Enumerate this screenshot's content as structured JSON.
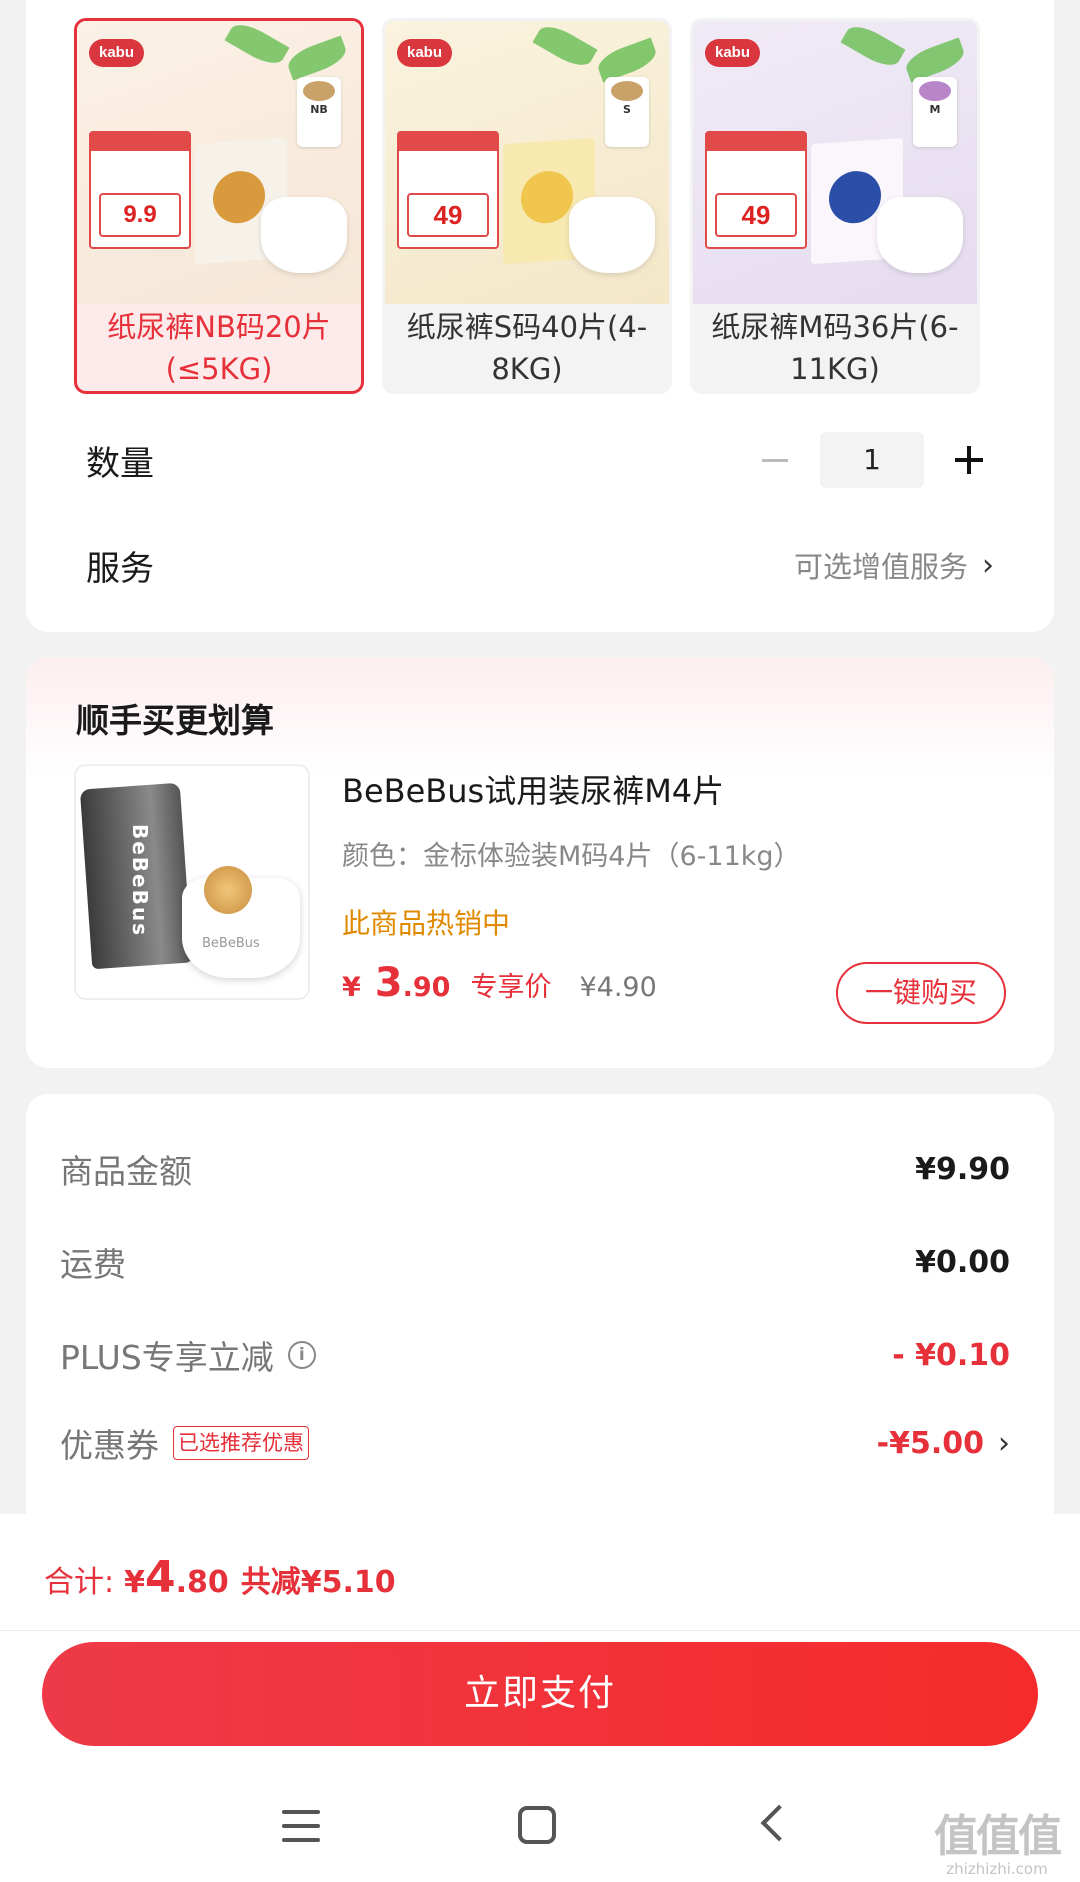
{
  "variants": [
    {
      "label": "纸尿裤NB码20片(≤5KG)",
      "selected": true,
      "brand": "kabu",
      "size_tag": "NB",
      "promo_price": "9.9"
    },
    {
      "label": "纸尿裤S码40片(4-8KG)",
      "selected": false,
      "brand": "kabu",
      "size_tag": "S",
      "promo_price": "49"
    },
    {
      "label": "纸尿裤M码36片(6-11KG)",
      "selected": false,
      "brand": "kabu",
      "size_tag": "M",
      "promo_price": "49"
    }
  ],
  "quantity": {
    "label": "数量",
    "value": "1"
  },
  "service": {
    "label": "服务",
    "value": "可选增值服务"
  },
  "addon": {
    "title": "顺手买更划算",
    "name": "BeBeBus试用装尿裤M4片",
    "spec": "颜色：金标体验装M码4片（6-11kg）",
    "status": "此商品热销中",
    "price_symbol": "¥",
    "price_int": "3",
    "price_dec": ".90",
    "price_tag": "专享价",
    "orig_price": "¥4.90",
    "buy_label": "一键购买",
    "thumb_brand": "BeBeBus"
  },
  "summary": {
    "items": [
      {
        "label": "商品金额",
        "value": "¥9.90",
        "red": false
      },
      {
        "label": "运费",
        "value": "¥0.00",
        "red": false
      },
      {
        "label": "PLUS专享立减",
        "value": "- ¥0.10",
        "red": true,
        "info": true
      },
      {
        "label": "优惠券",
        "value": "-¥5.00",
        "red": true,
        "badge": "已选推荐优惠",
        "chevron": true
      }
    ]
  },
  "total": {
    "label": "合计:",
    "symbol": "¥",
    "int": "4",
    "dec": ".80",
    "saved": "共减¥5.10"
  },
  "pay_button": "立即支付",
  "watermark": {
    "mark": "值值值",
    "url": "zhizhizhi.com"
  },
  "colors": {
    "accent": "#e6303a",
    "hot": "#e08a00",
    "muted": "#888888"
  }
}
